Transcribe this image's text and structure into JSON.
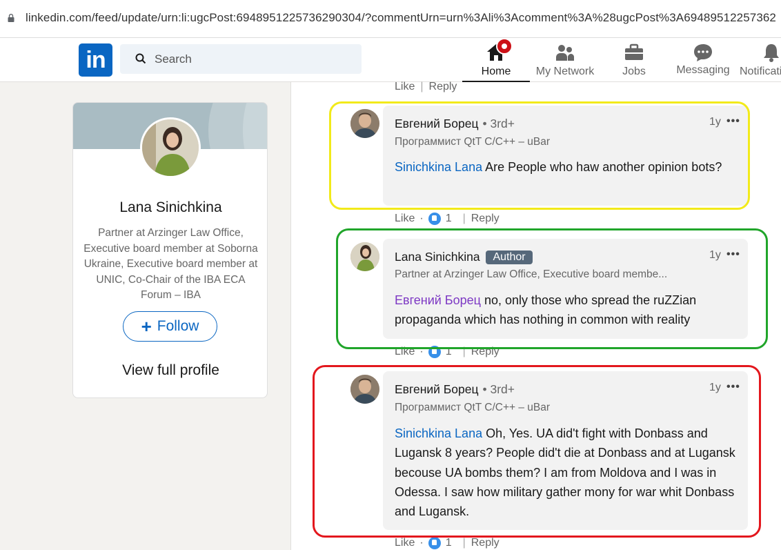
{
  "browser": {
    "url": "linkedin.com/feed/update/urn:li:ugcPost:6948951225736290304/?commentUrn=urn%3Ali%3Acomment%3A%28ugcPost%3A69489512257362"
  },
  "nav": {
    "logo": "in",
    "search_placeholder": "Search",
    "items": [
      {
        "label": "Home",
        "icon": "home-icon"
      },
      {
        "label": "My Network",
        "icon": "network-icon"
      },
      {
        "label": "Jobs",
        "icon": "briefcase-icon"
      },
      {
        "label": "Messaging",
        "icon": "messaging-icon"
      },
      {
        "label": "Notifications",
        "icon": "bell-icon"
      }
    ]
  },
  "profile": {
    "name": "Lana Sinichkina",
    "headline": "Partner at Arzinger Law Office, Executive board member at Soborna Ukraine, Executive board member at UNIC, Co-Chair of the IBA ECA Forum – IBA",
    "follow_label": "Follow",
    "view_profile_label": "View full profile"
  },
  "top_actions": {
    "like": "Like",
    "reply": "Reply"
  },
  "comments": [
    {
      "author": "Евгений Борец",
      "degree": "• 3rd+",
      "headline": "Программист QtT C/C++ – uBar",
      "time": "1y",
      "menu": "•••",
      "mention": "Sinichkina Lana",
      "text": " Are People who haw another opinion bots?",
      "like": "Like",
      "reactions": "1",
      "reply": "Reply"
    },
    {
      "author": "Lana Sinichkina",
      "badge": "Author",
      "headline": "Partner at Arzinger Law Office, Executive board membe...",
      "time": "1y",
      "menu": "•••",
      "mention": "Евгений Борец",
      "text": " no, only those who spread the ruZZian propaganda which has nothing in common with reality",
      "like": "Like",
      "reactions": "1",
      "reply": "Reply"
    },
    {
      "author": "Евгений Борец",
      "degree": "• 3rd+",
      "headline": "Программист QtT C/C++ – uBar",
      "time": "1y",
      "menu": "•••",
      "mention": "Sinichkina Lana",
      "text": " Oh, Yes. UA did't fight with Donbass and Lugansk 8 years? People did't die at Donbass and at Lugansk becouse UA bombs them? I am from Moldova and I was in Odessa. I saw how military gather mony for war whit Donbass and Lugansk.",
      "like": "Like",
      "reactions": "1",
      "reply": "Reply"
    }
  ],
  "colors": {
    "brand": "#0a66c2",
    "highlight_yellow": "#f2ea1a",
    "highlight_green": "#20a52a",
    "highlight_red": "#e3171d",
    "author_badge": "#56687a"
  }
}
